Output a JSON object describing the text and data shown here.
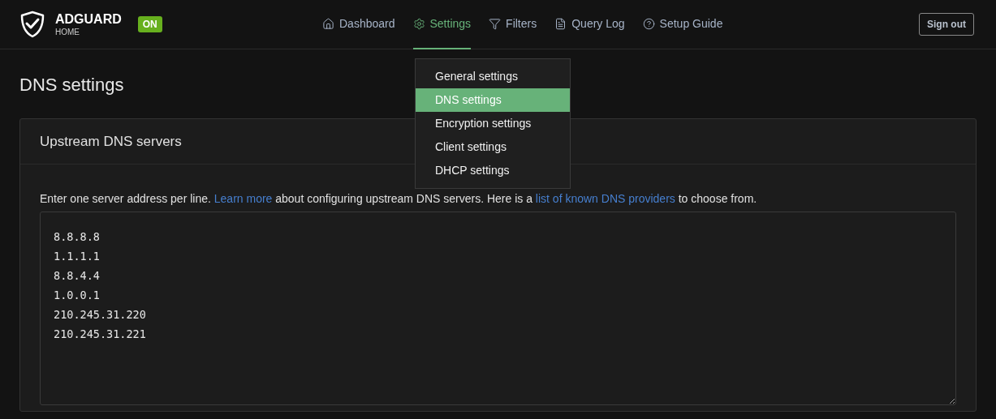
{
  "header": {
    "logo": {
      "name": "ADGUARD",
      "sub": "HOME"
    },
    "status_badge": "ON",
    "nav": [
      {
        "label": "Dashboard",
        "selected": false
      },
      {
        "label": "Settings",
        "selected": true
      },
      {
        "label": "Filters",
        "selected": false
      },
      {
        "label": "Query Log",
        "selected": false
      },
      {
        "label": "Setup Guide",
        "selected": false
      }
    ],
    "sign_out": "Sign out"
  },
  "settings_menu": [
    {
      "label": "General settings",
      "selected": false
    },
    {
      "label": "DNS settings",
      "selected": true
    },
    {
      "label": "Encryption settings",
      "selected": false
    },
    {
      "label": "Client settings",
      "selected": false
    },
    {
      "label": "DHCP settings",
      "selected": false
    }
  ],
  "page_title": "DNS settings",
  "card": {
    "title": "Upstream DNS servers",
    "description": [
      {
        "kind": "text",
        "text": "Enter one server address per line. "
      },
      {
        "kind": "link",
        "text": "Learn more"
      },
      {
        "kind": "text",
        "text": " about configuring upstream DNS servers. Here is a "
      },
      {
        "kind": "link",
        "text": "list of known DNS providers"
      },
      {
        "kind": "text",
        "text": " to choose from."
      }
    ],
    "upstreams": "8.8.8.8\n1.1.1.1\n8.8.4.4\n1.0.0.1\n210.245.31.220\n210.245.31.221"
  }
}
